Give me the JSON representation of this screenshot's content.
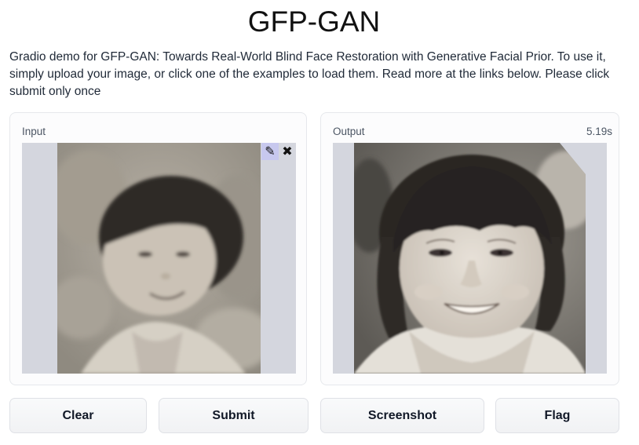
{
  "header": {
    "title": "GFP-GAN",
    "description": "Gradio demo for GFP-GAN: Towards Real-World Blind Face Restoration with Generative Facial Prior. To use it, simply upload your image, or click one of the examples to load them. Read more at the links below. Please click submit only once"
  },
  "input_panel": {
    "label": "Input",
    "edit_icon": "pencil-icon",
    "clear_icon": "close-icon"
  },
  "output_panel": {
    "label": "Output",
    "time": "5.19s"
  },
  "buttons": {
    "clear": "Clear",
    "submit": "Submit",
    "screenshot": "Screenshot",
    "flag": "Flag"
  }
}
